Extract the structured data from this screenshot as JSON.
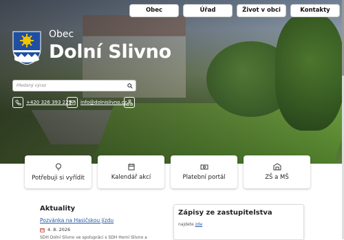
{
  "nav": {
    "items": [
      "Obec",
      "Úřad",
      "Život v obci",
      "Kontakty"
    ]
  },
  "hero": {
    "kicker": "Obec",
    "title": "Dolní Slivno"
  },
  "search": {
    "placeholder": "Hledaný výraz"
  },
  "contacts": {
    "phone": "+420 326 393 225",
    "email": "info@dolnislivno.cz"
  },
  "cards": [
    {
      "label": "Potřebuji si vyřídit",
      "icon": "bulb-icon"
    },
    {
      "label": "Kalendář akcí",
      "icon": "calendar-icon"
    },
    {
      "label": "Platební portál",
      "icon": "money-icon"
    },
    {
      "label": "ZŠ a MŠ",
      "icon": "school-icon"
    }
  ],
  "news": {
    "heading": "Aktuality",
    "item_title": "Pozvánka na Hasičskou jízdu",
    "item_date": "4. 8. 2026",
    "item_excerpt": "SDH Dolní Slivno ve spolupráci s SDH Horní Slivno a"
  },
  "minutes": {
    "heading": "Zápisy ze zastupitelstva",
    "prefix": "najdete",
    "link": "zde"
  },
  "colors": {
    "accent": "#2356a8",
    "crest_blue": "#1f4fa0",
    "crest_yellow": "#f2c300"
  }
}
